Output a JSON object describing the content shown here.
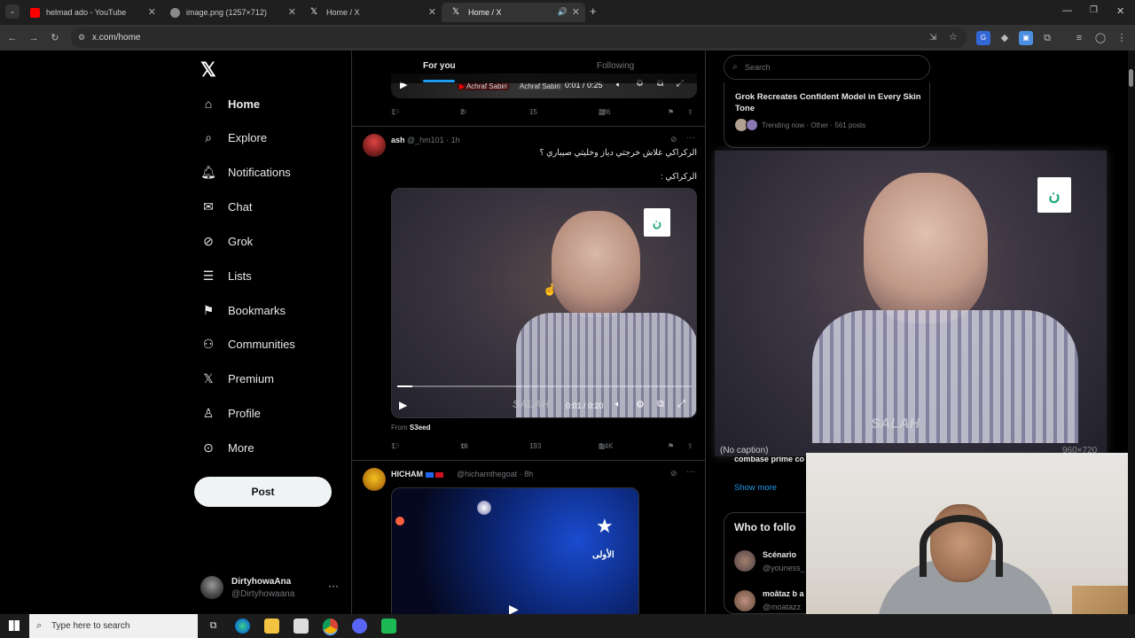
{
  "browser": {
    "tabs": [
      {
        "title": "helmad ado - YouTube",
        "favicon": "youtube-icon",
        "favicon_color": "#ff0000"
      },
      {
        "title": "image.png (1257×712)",
        "favicon": "globe-icon",
        "favicon_color": "#8a8a8a"
      },
      {
        "title": "Home / X",
        "favicon": "x-icon",
        "favicon_color": "#ffffff"
      },
      {
        "title": "Home / X",
        "favicon": "x-icon",
        "favicon_color": "#ffffff"
      }
    ],
    "new_tab": "+",
    "url": "x.com/home"
  },
  "nav": {
    "items": [
      {
        "label": "Home",
        "icon": "home-icon"
      },
      {
        "label": "Explore",
        "icon": "search-icon"
      },
      {
        "label": "Notifications",
        "icon": "bell-icon"
      },
      {
        "label": "Chat",
        "icon": "mail-icon"
      },
      {
        "label": "Grok",
        "icon": "grok-icon"
      },
      {
        "label": "Lists",
        "icon": "list-icon"
      },
      {
        "label": "Bookmarks",
        "icon": "bookmark-icon"
      },
      {
        "label": "Communities",
        "icon": "people-icon"
      },
      {
        "label": "Premium",
        "icon": "x-icon"
      },
      {
        "label": "Profile",
        "icon": "person-icon"
      },
      {
        "label": "More",
        "icon": "more-circle-icon"
      }
    ],
    "post_label": "Post",
    "user": {
      "name": "DirtyhowaAna",
      "handle": "@Dirtyhowaana"
    }
  },
  "feed": {
    "tabs": [
      "For you",
      "Following"
    ],
    "tweet0": {
      "video_time": "0:01 / 0:25",
      "overlay_names": [
        "Achraf Sabiri",
        "Achraf Sabiri"
      ],
      "stats": {
        "replies": "1",
        "reposts": "2",
        "likes": "15",
        "views": "286"
      }
    },
    "tweet1": {
      "name": "ash",
      "handle": "@_hm101",
      "time": "1h",
      "text_line1": "الركراكي علاش خرجتي دياز وخليتي صيباري ؟",
      "text_line2": "الركراكي :",
      "video_time": "0:01 / 0:20",
      "video_overlay": "SALAH",
      "from_label": "From",
      "from_source": "S3eed",
      "stats": {
        "replies": "1",
        "reposts": "16",
        "likes": "193",
        "views": "8.4K"
      }
    },
    "tweet2": {
      "name": "HICHAM",
      "handle": "@hichamthegoat",
      "time": "8h",
      "media_overlay": "الأولى"
    }
  },
  "right": {
    "search_placeholder": "Search",
    "trend": {
      "title": "Grok Recreates Confident Model in Every Skin Tone",
      "meta": "Trending now · Other · 561 posts"
    },
    "preview": {
      "caption": "(No caption)",
      "dims": "960×720",
      "overlay": "SALAH"
    },
    "hidden_trend": "combase prime co",
    "show_more": "Show more",
    "who_to_follow": {
      "title": "Who to follo",
      "accounts": [
        {
          "name": "Scénario",
          "handle": "@youness_"
        },
        {
          "name": "moâtaz b a",
          "handle": "@moatazz"
        }
      ]
    }
  },
  "taskbar": {
    "search_placeholder": "Type here to search"
  },
  "colors": {
    "accent": "#1d9bf0",
    "background": "#000000",
    "border": "#2f3336",
    "text_secondary": "#71767b"
  }
}
